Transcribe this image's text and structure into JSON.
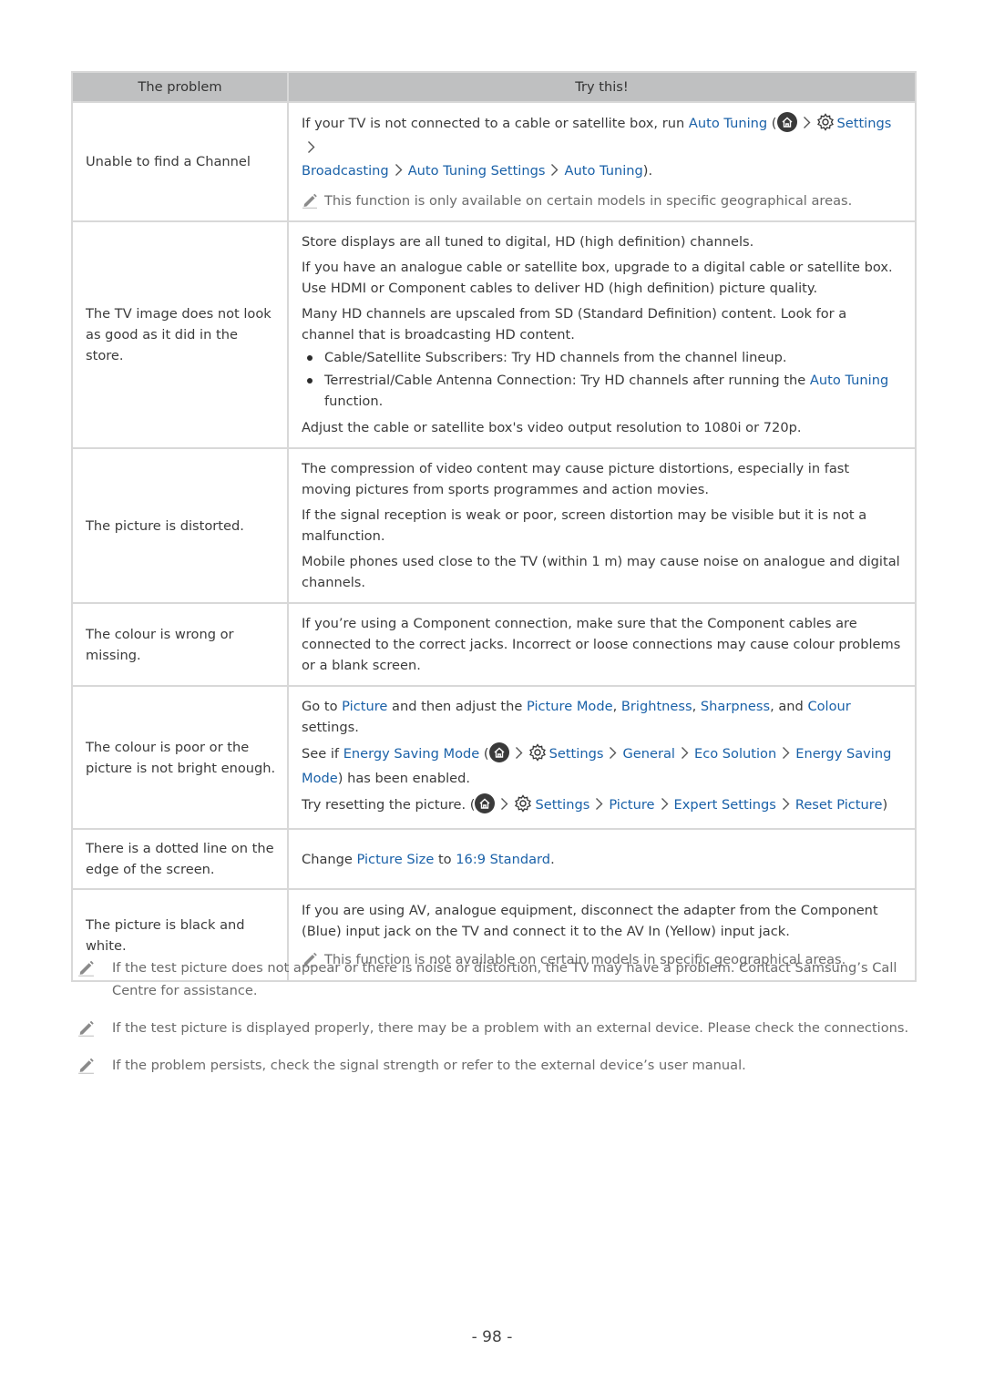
{
  "table": {
    "headers": {
      "problem": "The problem",
      "solution": "Try this!"
    },
    "rows": [
      {
        "problem": "Unable to find a Channel",
        "solution": {
          "p1": {
            "t1": "If your TV is not connected to a cable or satellite box, run ",
            "l1": "Auto Tuning",
            "t2": " (",
            "settings": "Settings",
            "broadcasting": "Broadcasting",
            "auto_tuning_settings": "Auto Tuning Settings",
            "auto_tuning": "Auto Tuning",
            "t3": ")."
          },
          "note": "This function is only available on certain models in specific geographical areas."
        }
      },
      {
        "problem": "The TV image does not look as good as it did in the store.",
        "solution": {
          "p1": "Store displays are all tuned to digital, HD (high definition) channels.",
          "p2": "If you have an analogue cable or satellite box, upgrade to a digital cable or satellite box. Use HDMI or Component cables to deliver HD (high definition) picture quality.",
          "p3": "Many HD channels are upscaled from SD (Standard Definition) content. Look for a channel that is broadcasting HD content.",
          "bullets": [
            {
              "text": "Cable/Satellite Subscribers: Try HD channels from the channel lineup."
            },
            {
              "text": "Terrestrial/Cable Antenna Connection: Try HD channels after running the ",
              "link": "Auto Tuning",
              "after": " function."
            }
          ],
          "p4": "Adjust the cable or satellite box's video output resolution to 1080i or 720p."
        }
      },
      {
        "problem": "The picture is distorted.",
        "solution": {
          "p1": "The compression of video content may cause picture distortions, especially in fast moving pictures from sports programmes and action movies.",
          "p2": "If the signal reception is weak or poor, screen distortion may be visible but it is not a malfunction.",
          "p3": "Mobile phones used close to the TV (within 1 m) may cause noise on analogue and digital channels."
        }
      },
      {
        "problem": "The colour is wrong or missing.",
        "solution": {
          "p1": "If you’re using a Component connection, make sure that the Component cables are connected to the correct jacks. Incorrect or loose connections may cause colour problems or a blank screen."
        }
      },
      {
        "problem": "The colour is poor or the picture is not bright enough.",
        "solution": {
          "p1": {
            "t1": "Go to ",
            "l1": "Picture",
            "t2": " and then adjust the ",
            "l2": "Picture Mode",
            "t3": ", ",
            "l3": "Brightness",
            "t4": ", ",
            "l4": "Sharpness",
            "t5": ", and ",
            "l5": "Colour",
            "t6": " settings."
          },
          "p2": {
            "t1": "See if ",
            "l1": "Energy Saving Mode",
            "t2": " (",
            "settings": "Settings",
            "general": "General",
            "eco": "Eco Solution",
            "energy": "Energy Saving Mode",
            "t3": ") has been enabled."
          },
          "p3": {
            "t1": "Try resetting the picture. (",
            "settings": "Settings",
            "picture": "Picture",
            "expert": "Expert Settings",
            "reset": "Reset Picture",
            "t2": ")"
          }
        }
      },
      {
        "problem": "There is a dotted line on the edge of the screen.",
        "solution": {
          "t1": "Change ",
          "l1": "Picture Size",
          "t2": " to ",
          "l2": "16:9 Standard",
          "t3": "."
        }
      },
      {
        "problem": "The picture is black and white.",
        "solution": {
          "p1": "If you are using AV, analogue equipment, disconnect the adapter from the Component (Blue) input jack on the TV and connect it to the AV In (Yellow) input jack.",
          "note": "This function is not available on certain models in specific geographical areas."
        }
      }
    ]
  },
  "footnotes": [
    "If the test picture does not appear or there is noise or distortion, the TV may have a problem. Contact Samsung’s Call Centre for assistance.",
    "If the test picture is displayed properly, there may be a problem with an external device. Please check the connections.",
    "If the problem persists, check the signal strength or refer to the external device’s user manual."
  ],
  "page_number": "- 98 -",
  "colors": {
    "link": "#1a61a8",
    "header_bg": "#bfc0c1",
    "border": "#d8d8d8",
    "note_text": "#6b6b6b"
  }
}
